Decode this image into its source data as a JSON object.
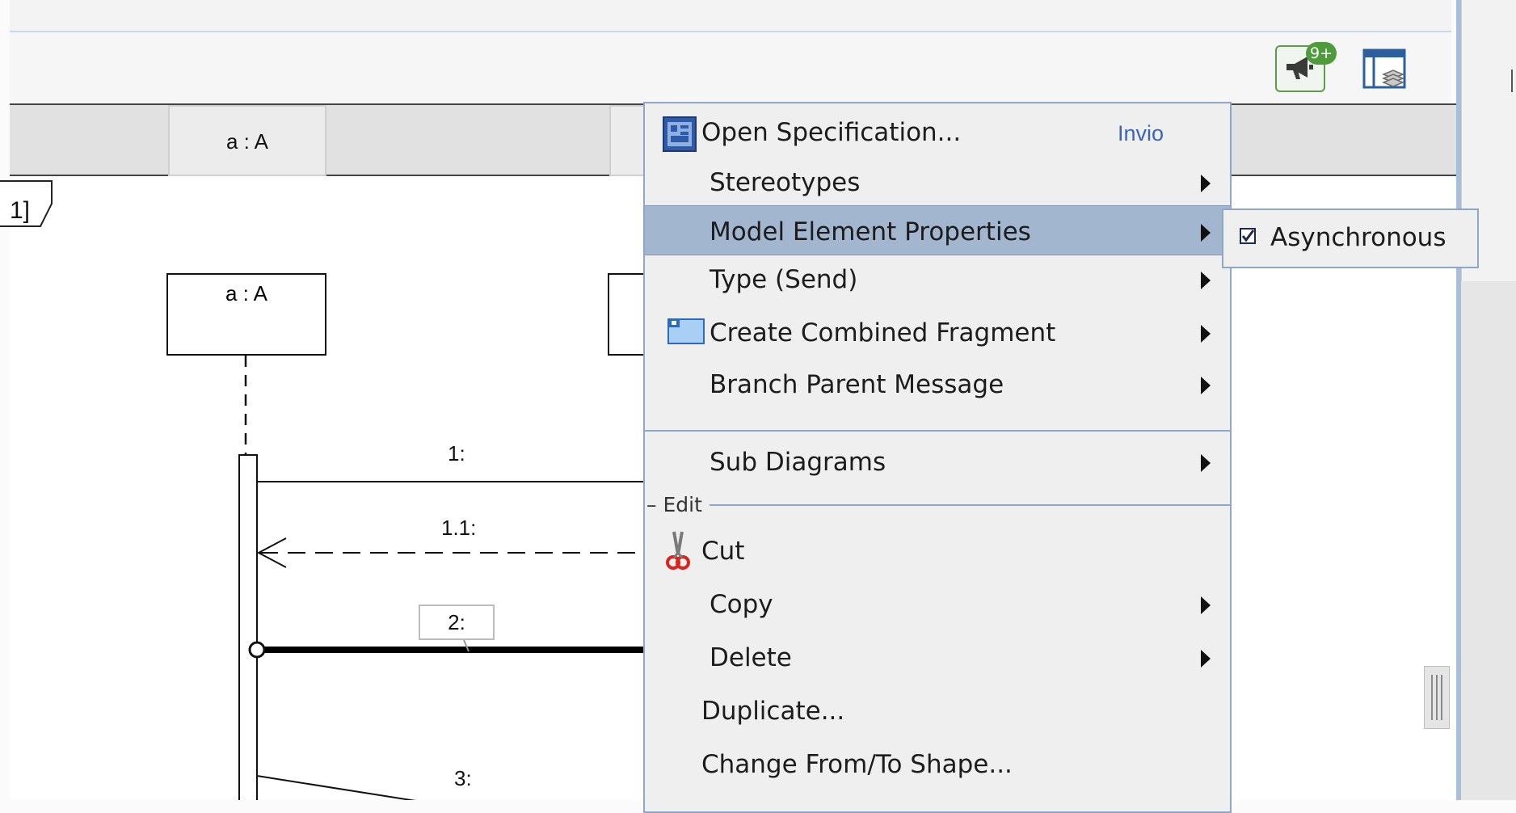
{
  "toolbar": {
    "notification_badge": "9+",
    "notification_icon": "megaphone-icon",
    "layers_icon": "layers-panel-icon"
  },
  "diagram": {
    "frame_tag": "1]",
    "lifeline_a_header": "a : A",
    "lifeline_a_box": "a : A",
    "messages": {
      "m1": "1:",
      "m11": "1.1:",
      "m2": "2:",
      "m3": "3:"
    }
  },
  "context_menu": {
    "open_specification": "Open Specification...",
    "open_specification_shortcut": "Invio",
    "stereotypes": "Stereotypes",
    "model_element_properties": "Model Element Properties",
    "type_send": "Type (Send)",
    "create_combined_fragment": "Create Combined Fragment",
    "branch_parent_message": "Branch Parent Message",
    "sub_diagrams": "Sub Diagrams",
    "edit_group": "Edit",
    "cut": "Cut",
    "copy": "Copy",
    "delete": "Delete",
    "duplicate": "Duplicate...",
    "change_from_to_shape": "Change From/To Shape..."
  },
  "submenu": {
    "asynchronous": "Asynchronous",
    "asynchronous_checked": true
  },
  "colors": {
    "menu_highlight": "#a3b6cf",
    "menu_border": "#8fa6c6",
    "shortcut_text": "#3b64b3",
    "badge": "#4f9a3a"
  }
}
